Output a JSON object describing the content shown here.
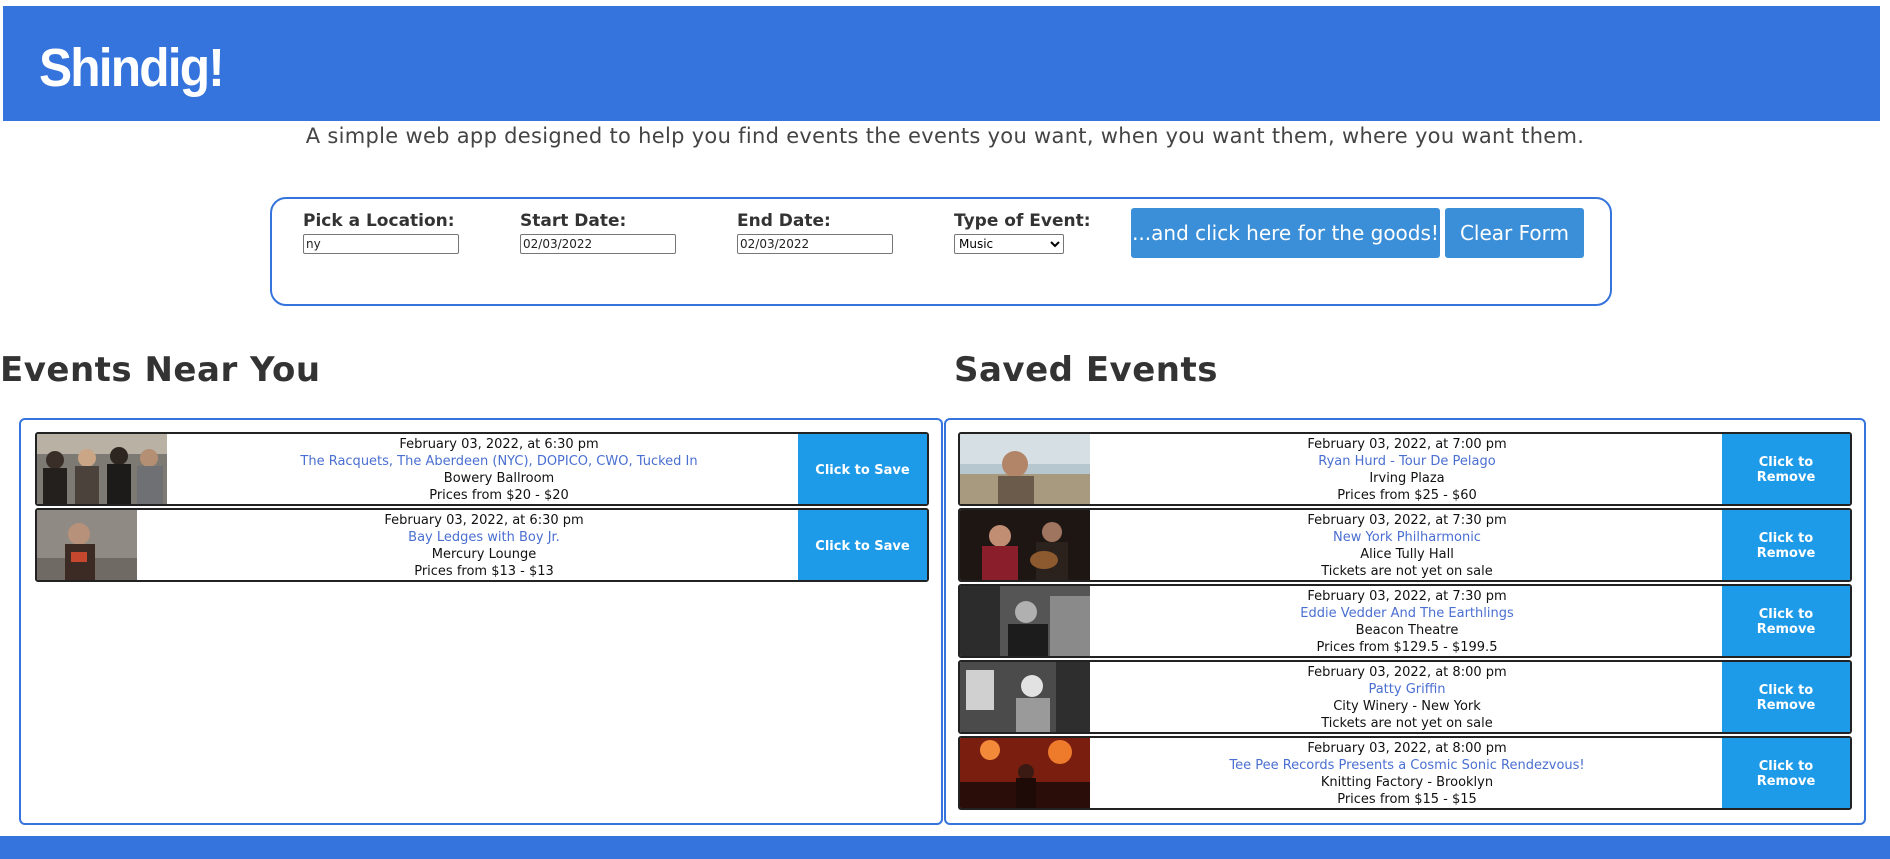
{
  "header": {
    "logo": "Shindig!",
    "tagline": "A simple web app designed to help you find events the events you want, when you want them, where you want them."
  },
  "search_form": {
    "location_label": "Pick a Location:",
    "location_value": "ny",
    "start_label": "Start Date:",
    "start_value": "02/03/2022",
    "end_label": "End Date:",
    "end_value": "02/03/2022",
    "type_label": "Type of Event:",
    "type_value": "Music",
    "submit_label": "...and click here for the goods!",
    "clear_label": "Clear Form"
  },
  "events_near": {
    "title": "Events Near You",
    "save_label": "Click to Save",
    "items": [
      {
        "date": "February 03, 2022, at 6:30 pm",
        "name": "The Racquets, The Aberdeen (NYC), DOPICO, CWO, Tucked In",
        "venue": "Bowery Ballroom",
        "price": "Prices from $20 - $20"
      },
      {
        "date": "February 03, 2022, at 6:30 pm",
        "name": "Bay Ledges with Boy Jr.",
        "venue": "Mercury Lounge",
        "price": "Prices from $13 - $13"
      }
    ]
  },
  "saved_events": {
    "title": "Saved Events",
    "remove_label": "Click to Remove",
    "items": [
      {
        "date": "February 03, 2022, at 7:00 pm",
        "name": "Ryan Hurd - Tour De Pelago",
        "venue": "Irving Plaza",
        "price": "Prices from $25 - $60"
      },
      {
        "date": "February 03, 2022, at 7:30 pm",
        "name": "New York Philharmonic",
        "venue": "Alice Tully Hall",
        "price": "Tickets are not yet on sale"
      },
      {
        "date": "February 03, 2022, at 7:30 pm",
        "name": "Eddie Vedder And The Earthlings",
        "venue": "Beacon Theatre",
        "price": "Prices from $129.5 - $199.5"
      },
      {
        "date": "February 03, 2022, at 8:00 pm",
        "name": "Patty Griffin",
        "venue": "City Winery - New York",
        "price": "Tickets are not yet on sale"
      },
      {
        "date": "February 03, 2022, at 8:00 pm",
        "name": "Tee Pee Records Presents a Cosmic Sonic Rendezvous!",
        "venue": "Knitting Factory - Brooklyn",
        "price": "Prices from $15 - $15"
      }
    ]
  },
  "colors": {
    "brand_blue": "#3674dd",
    "button_blue": "#1e9be8",
    "link_blue": "#4a6fd1"
  }
}
